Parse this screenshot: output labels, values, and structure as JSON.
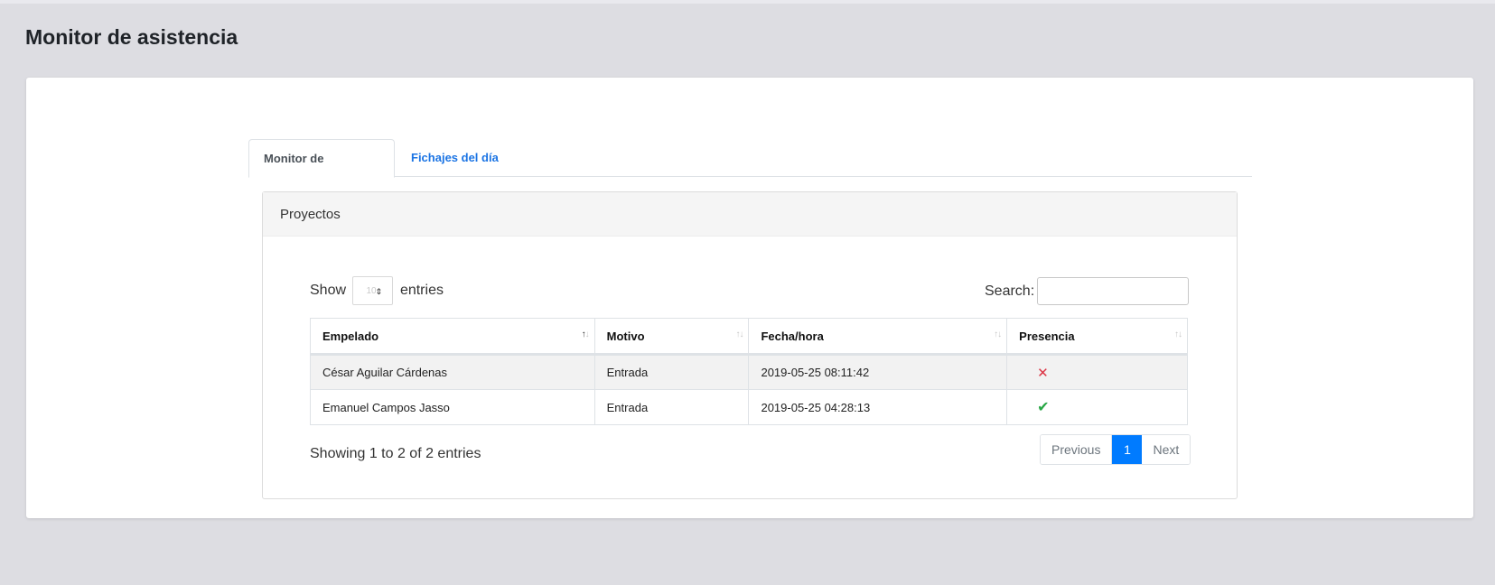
{
  "page": {
    "title": "Monitor de asistencia"
  },
  "tabs": [
    {
      "label": "Monitor de asistencia",
      "active": true
    },
    {
      "label": "Fichajes del día",
      "active": false
    }
  ],
  "panel": {
    "heading": "Proyectos"
  },
  "length": {
    "show_label": "Show",
    "value": "10",
    "entries_label": "entries"
  },
  "search": {
    "label": "Search:",
    "value": "",
    "placeholder": ""
  },
  "table": {
    "columns": [
      "Empelado",
      "Motivo",
      "Fecha/hora",
      "Presencia"
    ],
    "rows": [
      {
        "empleado": "César Aguilar Cárdenas",
        "motivo": "Entrada",
        "fecha": "2019-05-25 08:11:42",
        "presencia": "x-icon"
      },
      {
        "empleado": "Emanuel Campos Jasso",
        "motivo": "Entrada",
        "fecha": "2019-05-25 04:28:13",
        "presencia": "check-icon"
      }
    ]
  },
  "info": "Showing 1 to 2 of 2 entries",
  "pagination": {
    "previous": "Previous",
    "current": "1",
    "next": "Next"
  },
  "colors": {
    "accent": "#007bff",
    "tab_link": "#1b74e4",
    "absent": "#dc3545",
    "present": "#28a745"
  }
}
